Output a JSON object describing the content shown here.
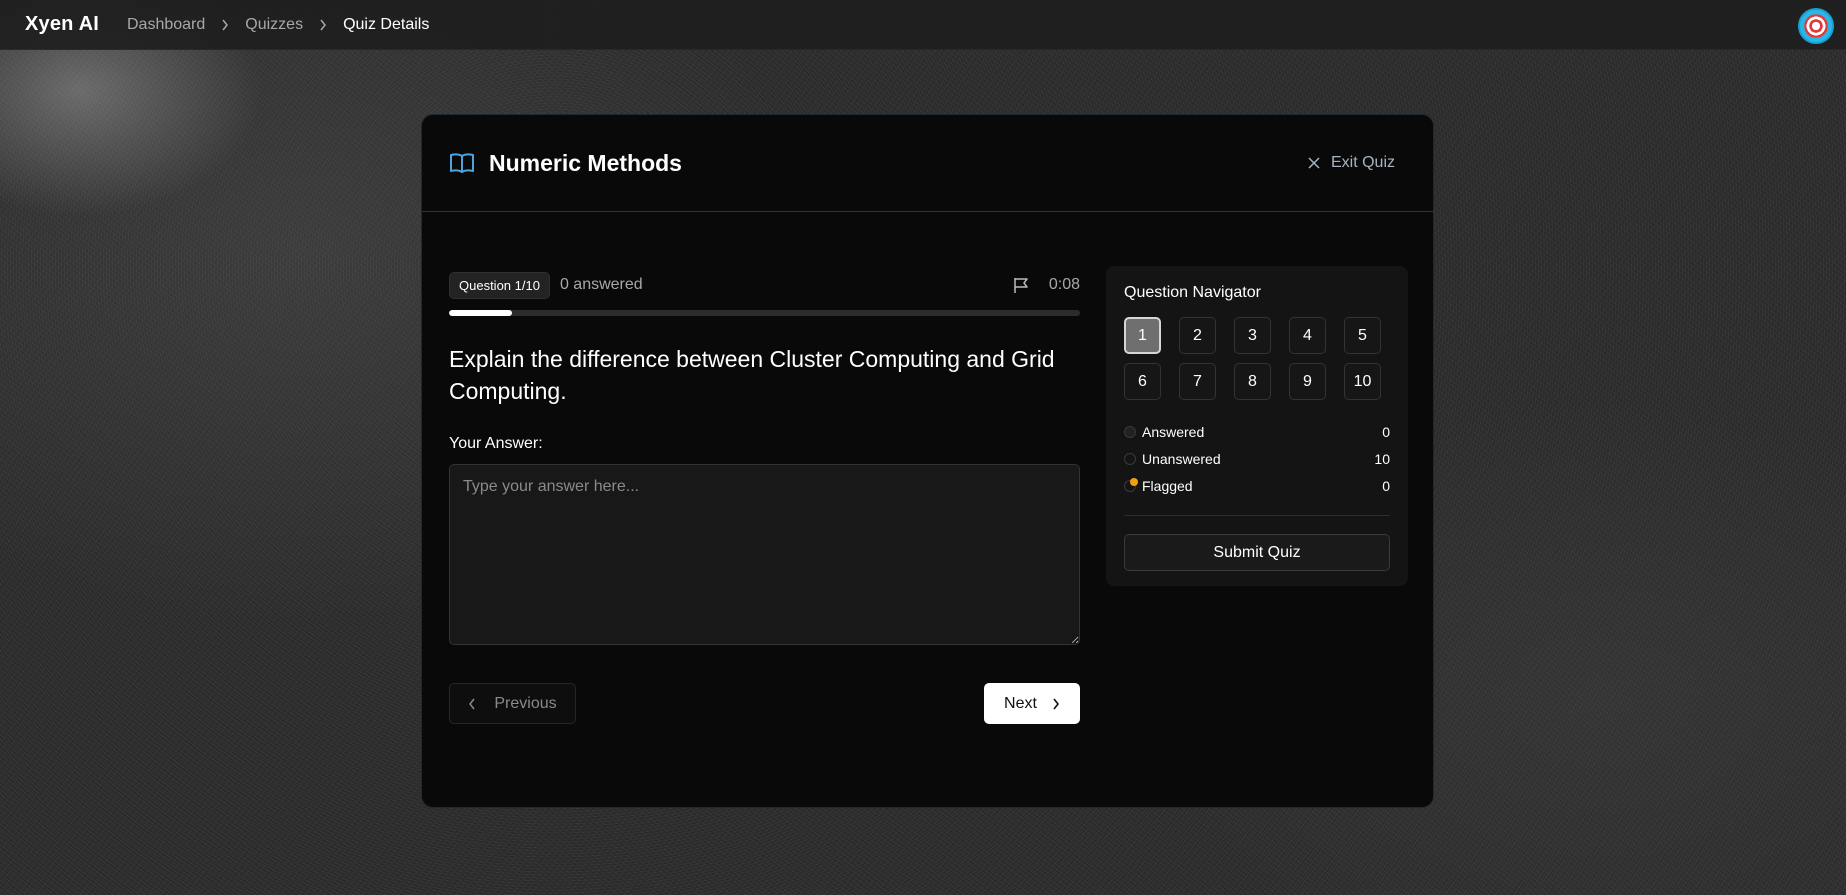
{
  "topbar": {
    "brand": "Xyen AI",
    "breadcrumb": [
      "Dashboard",
      "Quizzes",
      "Quiz Details"
    ]
  },
  "quiz": {
    "title": "Numeric Methods",
    "exit_label": "Exit Quiz",
    "question_badge": "Question 1/10",
    "answered_text": "0 answered",
    "timer": "0:08",
    "progress_fraction": 0.1,
    "question_text": "Explain the difference between Cluster Computing and Grid Computing.",
    "answer_label": "Your Answer:",
    "answer_placeholder": "Type your answer here...",
    "answer_value": "",
    "prev_label": "Previous",
    "next_label": "Next"
  },
  "navigator": {
    "title": "Question Navigator",
    "questions": [
      "1",
      "2",
      "3",
      "4",
      "5",
      "6",
      "7",
      "8",
      "9",
      "10"
    ],
    "current": "1",
    "legend": [
      {
        "label": "Answered",
        "count": "0"
      },
      {
        "label": "Unanswered",
        "count": "10"
      },
      {
        "label": "Flagged",
        "count": "0"
      }
    ],
    "submit_label": "Submit Quiz"
  },
  "colors": {
    "accent_blue": "#4da3e0",
    "flag_orange": "#f59e0b"
  },
  "icons": {
    "quiz": "open-book-icon",
    "exit": "close-icon",
    "flag": "flag-icon",
    "prev": "chevron-left-icon",
    "next": "chevron-right-icon",
    "breadcrumb_sep": "chevron-right-icon"
  }
}
